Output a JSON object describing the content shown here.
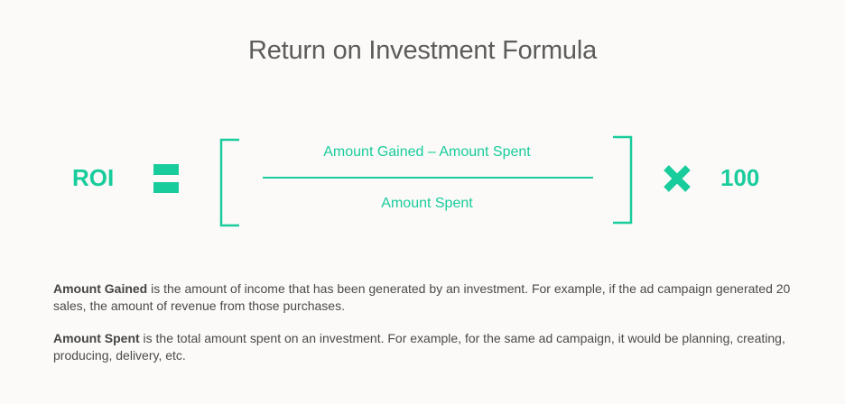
{
  "title": "Return on Investment Formula",
  "formula": {
    "result_label": "ROI",
    "equals_icon": "equals-icon",
    "numerator": "Amount Gained – Amount Spent",
    "denominator": "Amount Spent",
    "multiply_icon": "multiply-icon",
    "multiplier": "100"
  },
  "definitions": [
    {
      "term": "Amount Gained",
      "text": " is the amount of income that has been generated by an investment. For example, if the ad campaign generated 20 sales, the amount of revenue from those purchases."
    },
    {
      "term": "Amount Spent",
      "text": " is the total amount spent on an investment. For example, for the same ad campaign, it would be planning, creating, producing, delivery, etc."
    }
  ],
  "colors": {
    "accent": "#19cc9c",
    "background": "#fbfaf8",
    "title_text": "#5c5c5c",
    "body_text": "#4a4a4a"
  }
}
